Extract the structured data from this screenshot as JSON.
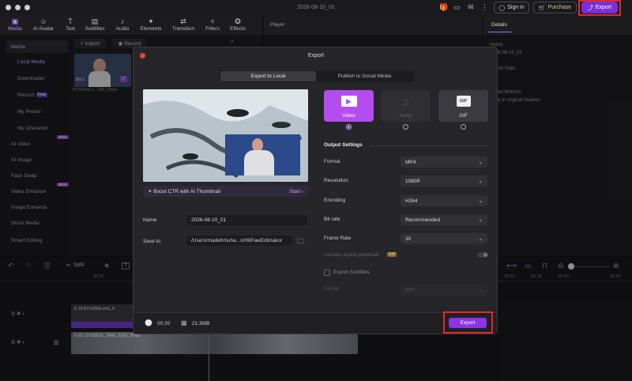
{
  "window": {
    "title": "2026-08-10_01"
  },
  "header": {
    "sign_in": "Sign in",
    "purchase": "Purchase",
    "export": "Export"
  },
  "toolbar": [
    {
      "label": "Media",
      "icon": "media-icon",
      "active": true
    },
    {
      "label": "AI Avatar",
      "icon": "avatar-icon"
    },
    {
      "label": "Text",
      "icon": "text-icon"
    },
    {
      "label": "Subtitles",
      "icon": "subtitles-icon"
    },
    {
      "label": "Audio",
      "icon": "audio-icon"
    },
    {
      "label": "Elements",
      "icon": "elements-icon"
    },
    {
      "label": "Transition",
      "icon": "transition-icon"
    },
    {
      "label": "Filters",
      "icon": "filters-icon"
    },
    {
      "label": "Effects",
      "icon": "effects-icon"
    }
  ],
  "sidebar": {
    "items": [
      {
        "label": "Media"
      },
      {
        "label": "Local Media"
      },
      {
        "label": "Downloader"
      },
      {
        "label": "Record",
        "badge": "Free"
      },
      {
        "label": "My Preset"
      },
      {
        "label": "My Character"
      },
      {
        "label": "AI Video",
        "badge": "NEW"
      },
      {
        "label": "AI Image"
      },
      {
        "label": "Face Swap"
      },
      {
        "label": "Video Enhance",
        "badge": "NEW"
      },
      {
        "label": "Image Enhance"
      },
      {
        "label": "Stock Media"
      },
      {
        "label": "Smart Editing"
      }
    ]
  },
  "media": {
    "import": "Import",
    "record": "Record",
    "clip_label": "8724366-u...160_25fps",
    "clip_time": "00:1"
  },
  "player": {
    "title": "Player"
  },
  "details": {
    "tab": "Details",
    "lines": [
      "Name:",
      "2026-08-10_01",
      "Frame Rate:",
      "Import Method:",
      "Keep in original location"
    ]
  },
  "dialog": {
    "title": "Export",
    "tab_local": "Export to Local",
    "tab_social": "Publish to Social Media",
    "boost": "Boost CTR with AI Thumbnail",
    "start": "Start",
    "name_label": "Name",
    "name_value": "2026-08-10_01",
    "saveto_label": "Save to",
    "saveto_value": "/Users/madehmuha...s/HitPawEdimakor",
    "duration": "00:20",
    "size": "21.3MB",
    "export_button": "Export",
    "formats": [
      {
        "label": "Video",
        "selected": true
      },
      {
        "label": "Audio",
        "selected": false
      },
      {
        "label": "GIF",
        "selected": false
      }
    ],
    "output_settings": "Output Settings",
    "settings": [
      {
        "label": "Format",
        "value": "MP4"
      },
      {
        "label": "Resolution",
        "value": "1080P"
      },
      {
        "label": "Encoding",
        "value": "H264"
      },
      {
        "label": "Bit rate",
        "value": "Recommended"
      },
      {
        "label": "Frame Rate",
        "value": "30"
      }
    ],
    "lossless": "Lossless export prioritized",
    "vip": "VIP",
    "export_subtitles": "Export Subtitles",
    "sub_format_label": "Format",
    "sub_format_value": "SRT"
  },
  "timeline": {
    "split": "Split",
    "clip1": "0:19 8724366-uhd_4",
    "clip2": "0:20 12703815_3840_2160_30fps",
    "ticks": [
      "00:02",
      "00:32",
      "00:36",
      "00:40",
      "00:45"
    ]
  }
}
